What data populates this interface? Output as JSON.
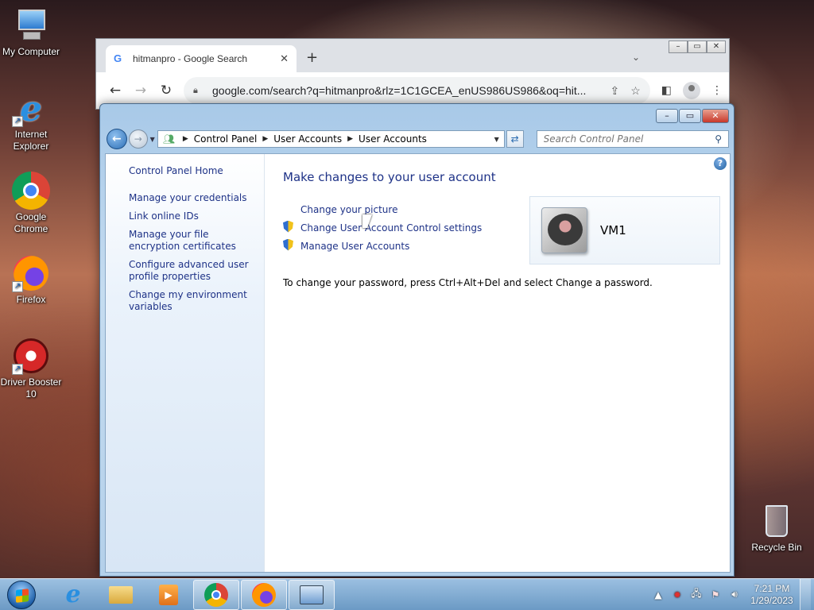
{
  "desktop": {
    "icons": [
      {
        "label": "My Computer"
      },
      {
        "label": "Internet Explorer"
      },
      {
        "label": "Google Chrome"
      },
      {
        "label": "Firefox"
      },
      {
        "label": "Driver Booster 10"
      }
    ],
    "recycle_bin": {
      "label": "Recycle Bin"
    }
  },
  "browser": {
    "tab_title": "hitmanpro - Google Search",
    "tab_close": "✕",
    "new_tab": "+",
    "url": "google.com/search?q=hitmanpro&rlz=1C1GCEA_enUS986US986&oq=hit..."
  },
  "control_panel": {
    "breadcrumbs": [
      "Control Panel",
      "User Accounts",
      "User Accounts"
    ],
    "search_placeholder": "Search Control Panel",
    "left_pane": {
      "home": "Control Panel Home",
      "links": [
        "Manage your credentials",
        "Link online IDs",
        "Manage your file encryption certificates",
        "Configure advanced user profile properties",
        "Change my environment variables"
      ]
    },
    "main": {
      "title": "Make changes to your user account",
      "tasks": [
        {
          "label": "Change your picture",
          "shield": false
        },
        {
          "label": "Change User Account Control settings",
          "shield": true
        },
        {
          "label": "Manage User Accounts",
          "shield": true
        }
      ],
      "password_note": "To change your password, press Ctrl+Alt+Del and select Change a password."
    },
    "account": {
      "name": "VM1"
    }
  },
  "taskbar": {
    "clock_time": "7:21 PM",
    "clock_date": "1/29/2023"
  },
  "colors": {
    "link": "#1e3287",
    "taskbar": "#7fb0dc"
  }
}
